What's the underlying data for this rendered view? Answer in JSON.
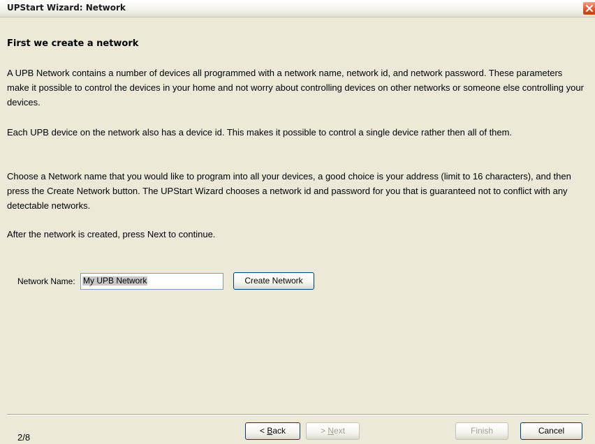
{
  "window": {
    "title": "UPStart Wizard: Network"
  },
  "page": {
    "heading": "First we create a network",
    "paragraphs": [
      "A UPB Network contains a number of devices all programmed with a network name, network id, and network password. These parameters make it possible to control the devices in your home and not worry about controlling devices on other networks or someone else controlling your devices.",
      "Each UPB device on the network also has a device id. This makes it possible to control a single device rather then all of them.",
      "Choose a Network name that you would like to program into all your devices, a good choice is your address (limit to 16 characters), and then press the Create Network button. The UPStart Wizard chooses a network id and password for you that is guaranteed not to conflict with any detectable networks.",
      "After the network is created, press Next to continue."
    ]
  },
  "form": {
    "network_name_label": "Network Name:",
    "network_name_value": "My UPB Network",
    "create_button": "Create Network"
  },
  "footer": {
    "step": "2/8",
    "back_prefix": "< ",
    "back_key": "B",
    "back_rest": "ack",
    "next_prefix": "> ",
    "next_key": "N",
    "next_rest": "ext",
    "finish": "Finish",
    "cancel": "Cancel"
  },
  "icons": {
    "close": "close-icon"
  },
  "colors": {
    "dialog_bg": "#ece9d8",
    "close_button": "#e4572e",
    "disabled_text": "#a3a08f"
  }
}
